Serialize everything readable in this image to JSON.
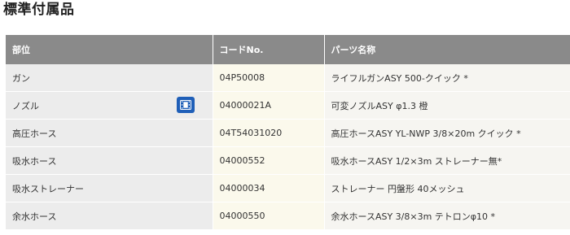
{
  "section_title": "標準付属品",
  "table": {
    "headers": [
      "部位",
      "コードNo.",
      "パーツ名称"
    ],
    "rows": [
      {
        "part": "ガン",
        "code": "04P50008",
        "name": "ライフルガンASY 500-クイック *"
      },
      {
        "part": "ノズル",
        "code": "04000021A",
        "name": "可変ノズルASY φ1.3 橙",
        "icon": "video-icon"
      },
      {
        "part": "高圧ホース",
        "code": "04T54031020",
        "name": "高圧ホースASY YL-NWP 3/8×20m クイック *"
      },
      {
        "part": "吸水ホース",
        "code": "04000552",
        "name": "吸水ホースASY 1/2×3m ストレーナー無*"
      },
      {
        "part": "吸水ストレーナー",
        "code": "04000034",
        "name": "ストレーナー 円盤形 40メッシュ"
      },
      {
        "part": "余水ホース",
        "code": "04000550",
        "name": "余水ホースASY 3/8×3m テトロンφ10 *"
      }
    ]
  },
  "colors": {
    "header_bg": "#8a8a8a",
    "video_button": "#1f5fb8"
  }
}
